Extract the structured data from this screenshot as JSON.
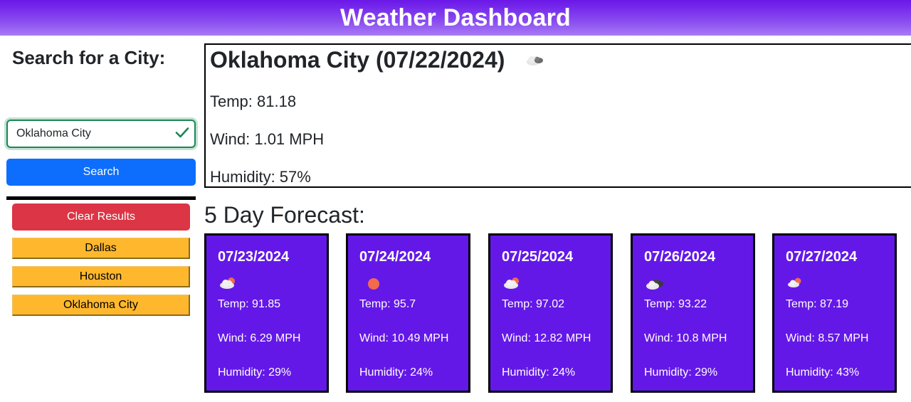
{
  "header": {
    "title": "Weather Dashboard"
  },
  "sidebar": {
    "heading": "Search for a City:",
    "search_value": "Oklahoma City",
    "search_button": "Search",
    "clear_button": "Clear Results",
    "history": [
      "Dallas",
      "Houston",
      "Oklahoma City"
    ]
  },
  "current": {
    "title": "Oklahoma City (07/22/2024)",
    "icon": "cloud-icon",
    "temp": "Temp: 81.18",
    "wind": "Wind: 1.01 MPH",
    "humidity": "Humidity: 57%"
  },
  "forecast": {
    "heading": "5 Day Forecast:",
    "days": [
      {
        "date": "07/23/2024",
        "icon": "cloud-sun-icon",
        "temp": "Temp: 91.85",
        "wind": "Wind: 6.29 MPH",
        "humidity": "Humidity: 29%"
      },
      {
        "date": "07/24/2024",
        "icon": "sun-icon",
        "temp": "Temp: 95.7",
        "wind": "Wind: 10.49 MPH",
        "humidity": "Humidity: 24%"
      },
      {
        "date": "07/25/2024",
        "icon": "cloud-sun-icon",
        "temp": "Temp: 97.02",
        "wind": "Wind: 12.82 MPH",
        "humidity": "Humidity: 24%"
      },
      {
        "date": "07/26/2024",
        "icon": "clouds-icon",
        "temp": "Temp: 93.22",
        "wind": "Wind: 10.8 MPH",
        "humidity": "Humidity: 29%"
      },
      {
        "date": "07/27/2024",
        "icon": "cloud-sun-icon",
        "temp": "Temp: 87.19",
        "wind": "Wind: 8.57 MPH",
        "humidity": "Humidity: 43%"
      }
    ]
  },
  "colors": {
    "header_gradient_top": "#6a17e8",
    "card_background": "#6418e8",
    "search_button": "#0d6efd",
    "clear_button": "#dc3545",
    "history_button": "#ffb82e",
    "valid_green": "#198754"
  }
}
